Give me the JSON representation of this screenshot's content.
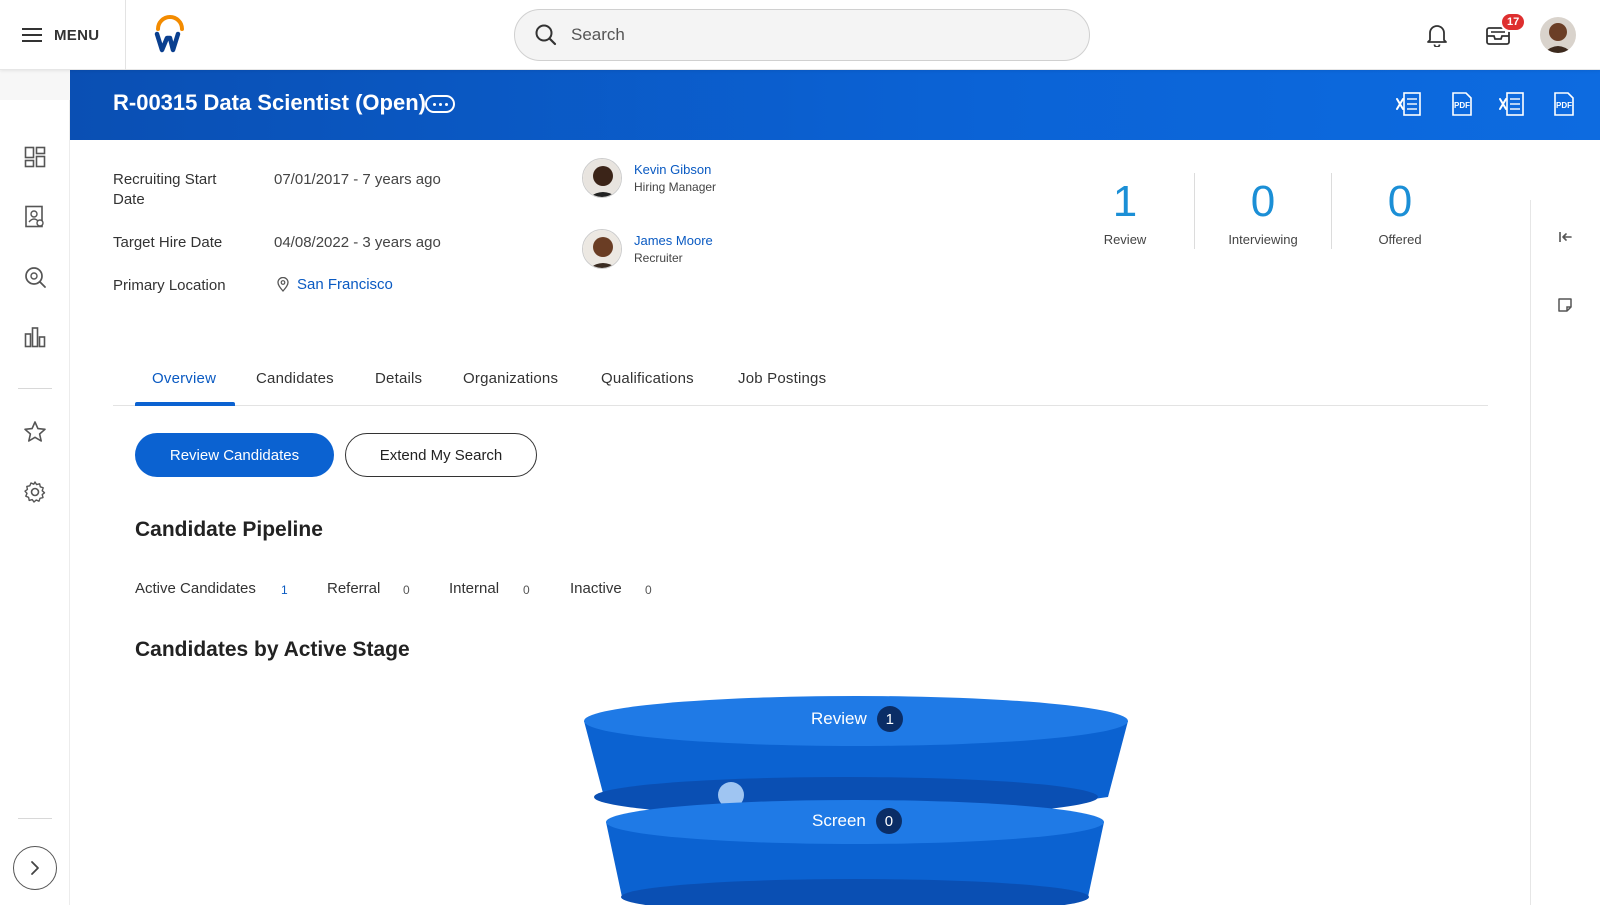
{
  "topbar": {
    "menu_label": "MENU",
    "search_placeholder": "Search",
    "inbox_badge": "17"
  },
  "header": {
    "title": "R-00315 Data Scientist (Open)"
  },
  "info": {
    "recruiting_start_label": "Recruiting Start Date",
    "recruiting_start_value": "07/01/2017 - 7 years ago",
    "target_hire_label": "Target Hire Date",
    "target_hire_value": "04/08/2022 - 3 years ago",
    "primary_location_label": "Primary Location",
    "primary_location_value": "San Francisco"
  },
  "people": [
    {
      "name": "Kevin Gibson",
      "role": "Hiring Manager"
    },
    {
      "name": "James Moore",
      "role": "Recruiter"
    }
  ],
  "stats": [
    {
      "value": "1",
      "label": "Review"
    },
    {
      "value": "0",
      "label": "Interviewing"
    },
    {
      "value": "0",
      "label": "Offered"
    }
  ],
  "tabs": [
    "Overview",
    "Candidates",
    "Details",
    "Organizations",
    "Qualifications",
    "Job Postings"
  ],
  "active_tab": "Overview",
  "actions": {
    "primary": "Review Candidates",
    "secondary": "Extend My Search"
  },
  "pipeline": {
    "title": "Candidate Pipeline",
    "items": [
      {
        "label": "Active Candidates",
        "count": "1"
      },
      {
        "label": "Referral",
        "count": "0"
      },
      {
        "label": "Internal",
        "count": "0"
      },
      {
        "label": "Inactive",
        "count": "0"
      }
    ]
  },
  "stages": {
    "title": "Candidates by Active Stage",
    "items": [
      {
        "label": "Review",
        "count": "1"
      },
      {
        "label": "Screen",
        "count": "0"
      }
    ]
  },
  "colors": {
    "brand_blue": "#0b62d1",
    "stat_blue": "#1b8fd6",
    "link_blue": "#0a5ac2",
    "badge_red": "#de2f2f"
  }
}
